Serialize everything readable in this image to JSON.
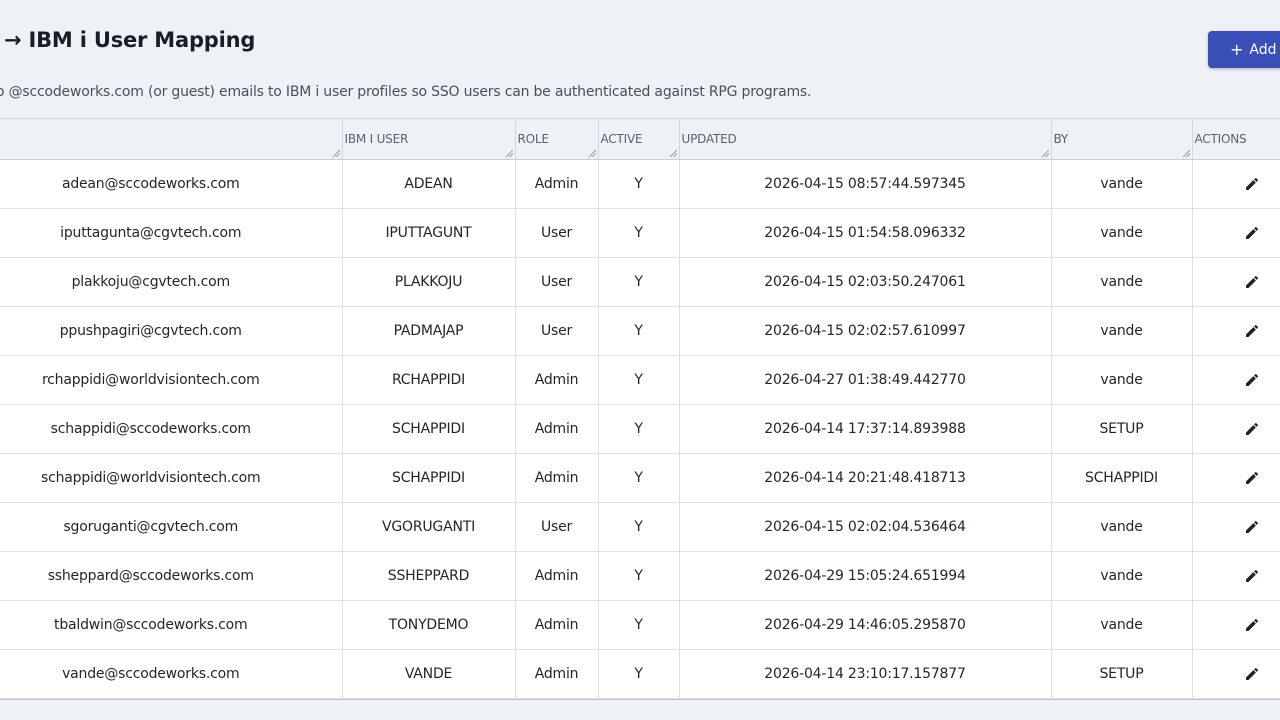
{
  "header": {
    "title": "→ IBM i User Mapping",
    "subtitle": "o @sccodeworks.com (or guest) emails to IBM i user profiles so SSO users can be authenticated against RPG programs.",
    "add_label": "Add"
  },
  "table": {
    "columns": [
      "",
      "IBM i USER",
      "ROLE",
      "ACTIVE",
      "UPDATED",
      "BY",
      "ACTIONS"
    ],
    "rows": [
      {
        "email": "adean@sccodeworks.com",
        "ibm_user": "ADEAN",
        "role": "Admin",
        "active": "Y",
        "updated": "2026-04-15 08:57:44.597345",
        "by": "vande"
      },
      {
        "email": "iputtagunta@cgvtech.com",
        "ibm_user": "IPUTTAGUNT",
        "role": "User",
        "active": "Y",
        "updated": "2026-04-15 01:54:58.096332",
        "by": "vande"
      },
      {
        "email": "plakkoju@cgvtech.com",
        "ibm_user": "PLAKKOJU",
        "role": "User",
        "active": "Y",
        "updated": "2026-04-15 02:03:50.247061",
        "by": "vande"
      },
      {
        "email": "ppushpagiri@cgvtech.com",
        "ibm_user": "PADMAJAP",
        "role": "User",
        "active": "Y",
        "updated": "2026-04-15 02:02:57.610997",
        "by": "vande"
      },
      {
        "email": "rchappidi@worldvisiontech.com",
        "ibm_user": "RCHAPPIDI",
        "role": "Admin",
        "active": "Y",
        "updated": "2026-04-27 01:38:49.442770",
        "by": "vande"
      },
      {
        "email": "schappidi@sccodeworks.com",
        "ibm_user": "SCHAPPIDI",
        "role": "Admin",
        "active": "Y",
        "updated": "2026-04-14 17:37:14.893988",
        "by": "SETUP"
      },
      {
        "email": "schappidi@worldvisiontech.com",
        "ibm_user": "SCHAPPIDI",
        "role": "Admin",
        "active": "Y",
        "updated": "2026-04-14 20:21:48.418713",
        "by": "SCHAPPIDI"
      },
      {
        "email": "sgoruganti@cgvtech.com",
        "ibm_user": "VGORUGANTI",
        "role": "User",
        "active": "Y",
        "updated": "2026-04-15 02:02:04.536464",
        "by": "vande"
      },
      {
        "email": "ssheppard@sccodeworks.com",
        "ibm_user": "SSHEPPARD",
        "role": "Admin",
        "active": "Y",
        "updated": "2026-04-29 15:05:24.651994",
        "by": "vande"
      },
      {
        "email": "tbaldwin@sccodeworks.com",
        "ibm_user": "TONYDEMO",
        "role": "Admin",
        "active": "Y",
        "updated": "2026-04-29 14:46:05.295870",
        "by": "vande"
      },
      {
        "email": "vande@sccodeworks.com",
        "ibm_user": "VANDE",
        "role": "Admin",
        "active": "Y",
        "updated": "2026-04-14 23:10:17.157877",
        "by": "SETUP"
      }
    ]
  },
  "icons": {
    "add": "plus-icon",
    "edit": "pencil-icon"
  },
  "colors": {
    "accent": "#3b4fb8",
    "background": "#eef1f5"
  }
}
